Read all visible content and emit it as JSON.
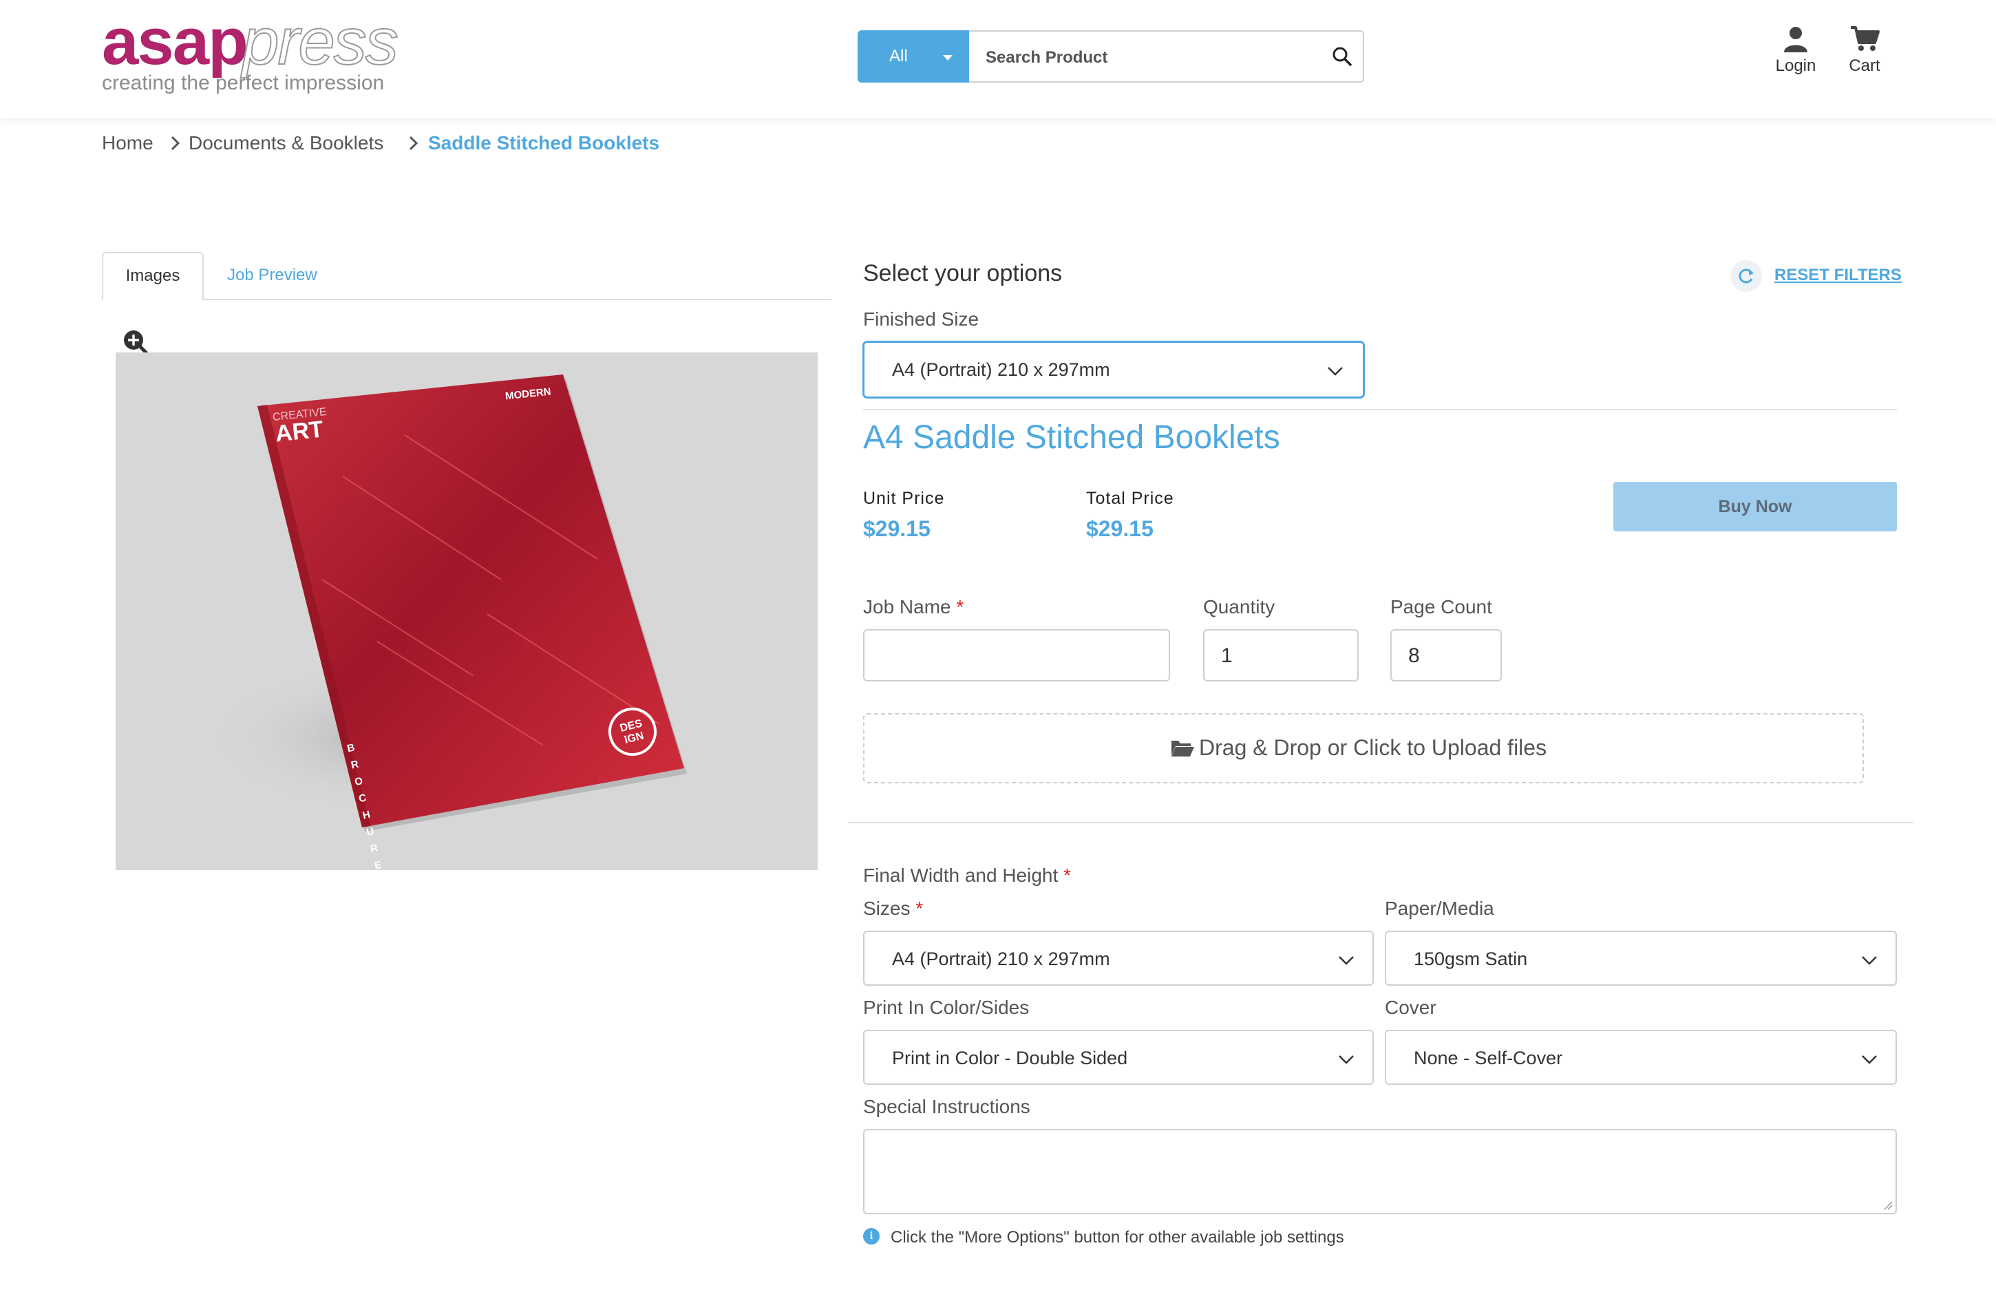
{
  "header": {
    "logo_part1": "asap",
    "logo_part2": "press",
    "tagline": "creating the perfect impression",
    "search_category": "All",
    "search_placeholder": "Search Product",
    "login_label": "Login",
    "cart_label": "Cart"
  },
  "breadcrumb": [
    {
      "label": "Home"
    },
    {
      "label": "Documents & Booklets"
    },
    {
      "label": "Saddle Stitched Booklets",
      "current": true
    }
  ],
  "tabs": [
    {
      "label": "Images",
      "active": true
    },
    {
      "label": "Job Preview",
      "active": false
    }
  ],
  "product_image": {
    "cover_line1": "CREATIVE",
    "cover_line2": "ART",
    "cover_corner": "MODERN",
    "cover_spine": "BROCHURE",
    "cover_badge_line1": "DES",
    "cover_badge_line2": "IGN"
  },
  "options": {
    "heading": "Select your options",
    "reset_label": "RESET FILTERS",
    "finished_size_label": "Finished Size",
    "finished_size_value": "A4 (Portrait) 210 x 297mm"
  },
  "product": {
    "title": "A4 Saddle Stitched Booklets",
    "unit_price_label": "Unit Price",
    "unit_price": "$29.15",
    "total_price_label": "Total Price",
    "total_price": "$29.15",
    "buy_label": "Buy Now"
  },
  "job": {
    "job_name_label": "Job Name",
    "required_mark": "*",
    "quantity_label": "Quantity",
    "quantity_value": "1",
    "page_count_label": "Page Count",
    "page_count_value": "8",
    "upload_label": "Drag & Drop or Click to Upload files"
  },
  "specs": {
    "final_wh_label": "Final Width and Height",
    "sizes_label": "Sizes",
    "sizes_value": "A4 (Portrait) 210 x 297mm",
    "paper_label": "Paper/Media",
    "paper_value": "150gsm Satin",
    "print_label": "Print In Color/Sides",
    "print_value": "Print in Color - Double Sided",
    "cover_label": "Cover",
    "cover_value": "None - Self-Cover",
    "special_label": "Special Instructions",
    "info_note": "Click the \"More Options\" button for other available job settings"
  },
  "colors": {
    "accent": "#4fa8e0",
    "brand": "#b0246b",
    "buy_button": "#9fcdee",
    "required": "#e02020"
  }
}
